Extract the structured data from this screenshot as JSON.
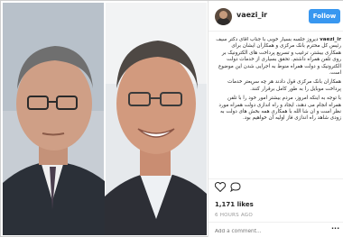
{
  "post": {
    "username": "vaezi_ir",
    "follow_label": "Follow",
    "caption_author": "vaezi_ir",
    "caption_paragraphs": [
      "دیروز جلسه بسیار خوبی با جناب آقای دکتر سیف رئیس کل محترم بانک مرکزی و همکاران ایشان برای همکاری بیشتر، ترغیب و تسریع پرداخت های الکترونیک بر روی تلفن همراه داشتم. تحقق بسیاری از خدمات دولت الکترونیک و دولت همراه منوط به اجرایی شدن این موضوع است.",
      "همکاران بانک مرکزی قول دادند هر چه سریعتر خدمات پرداخت موبایل را به طور کامل برقرار کنند.",
      "با توجه به اینکه امروز، مردم بیشتر امور خود را با تلفن همراه انجام می دهند، ایجاد و راه اندازی دولت همراه مورد نظر است و ان شا الله با همکاری همه بخش های دولت به زودی شاهد راه اندازی فاز اولیه آن خواهیم بود."
    ],
    "likes": "1,171 likes",
    "time_ago": "6 HOURS AGO",
    "comment_placeholder": "Add a comment...",
    "more_label": "···"
  }
}
